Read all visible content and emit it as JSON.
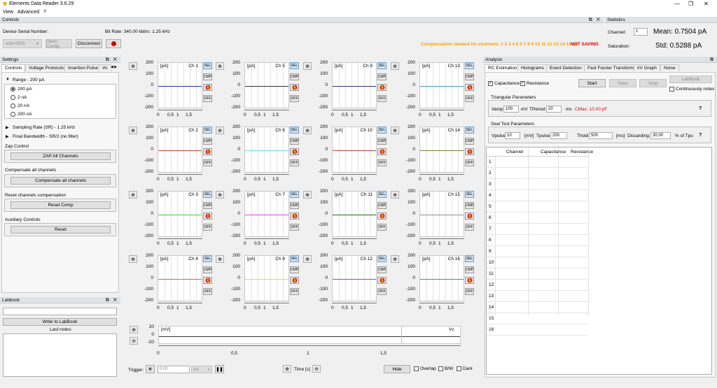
{
  "window": {
    "title": "Elements Data Reader 3.6.29",
    "controls": [
      "—",
      "❐",
      "✕"
    ]
  },
  "menu": [
    "View",
    "Advanced",
    "?"
  ],
  "controls_panel": {
    "header": "Controls",
    "serial_label": "Device Serial Number:",
    "serial_value": "e16-0003",
    "open_config": "Open Config",
    "disconnect": "Disconnect",
    "bitrate": "Bit Rate: 340.00 kbit/s: 1.25 kHz",
    "compensation_text": "Compensation needed for channels: 1 2 3 4 5 6 7 8 9 10 11 12 13 14 15 16",
    "not_saving": "NOT SAVING"
  },
  "statistics": {
    "header": "Statistics",
    "channel_label": "Channel:",
    "channel_value": "1",
    "mean": "Mean: 0.7504 pA",
    "saturation_label": "Saturation:",
    "std": "Std: 0.5288 pA"
  },
  "settings": {
    "header": "Settings",
    "tabs": [
      "Controls",
      "Voltage Protocols",
      "Insertion Pulse",
      "Vo"
    ],
    "range_label": "Range - 200 pA",
    "range_options": [
      "200 pA",
      "2 nA",
      "20 nA",
      "200 nA"
    ],
    "sampling_rate": "Sampling Rate (SR) - 1.25 kHz",
    "final_bandwidth": "Final Bandwidth - SR/2 (no filter)",
    "zap_section": "Zap Control",
    "zap_button": "ZAP All Channels",
    "comp_section": "Compensate all channels",
    "comp_button": "Compensate all channels",
    "reset_section": "Reset channels compensation",
    "reset_button": "Reset Comp",
    "aux_section": "Auxiliary Controls",
    "aux_button": "Reset"
  },
  "labbook": {
    "header": "Labbook",
    "write_button": "Write to LabBook",
    "last_notes": "Last notes:"
  },
  "plots": {
    "unit": "[pA]",
    "y_ticks": [
      "200",
      "100",
      "0",
      "-100",
      "-200"
    ],
    "x_ticks": [
      "0",
      "0,5",
      "1",
      "1,5"
    ],
    "channels": [
      {
        "label": "Ch 1",
        "color": "#2233cc"
      },
      {
        "label": "Ch 2",
        "color": "#e04040"
      },
      {
        "label": "Ch 3",
        "color": "#40d040"
      },
      {
        "label": "Ch 4",
        "color": "#d07020"
      },
      {
        "label": "Ch 5",
        "color": "#303030"
      },
      {
        "label": "Ch 6",
        "color": "#60e0e0"
      },
      {
        "label": "Ch 7",
        "color": "#e040e0"
      },
      {
        "label": "Ch 8",
        "color": "#e8e020"
      },
      {
        "label": "Ch 9",
        "color": "#303090"
      },
      {
        "label": "Ch 10",
        "color": "#d04040"
      },
      {
        "label": "Ch 11",
        "color": "#207020"
      },
      {
        "label": "Ch 12",
        "color": "#a040c0"
      },
      {
        "label": "Ch 13",
        "color": "#40a0c0"
      },
      {
        "label": "Ch 14",
        "color": "#808020"
      },
      {
        "label": "Ch 15",
        "color": "#909090"
      },
      {
        "label": "Ch 16",
        "color": "#20a080"
      }
    ],
    "side_buttons": [
      "SEL",
      "CMP",
      "OFF"
    ],
    "vc": {
      "unit": "[mV]",
      "label": "Vc",
      "y_ticks": [
        "20",
        "0",
        "-20"
      ],
      "x_ticks": [
        "0",
        "0,5",
        "1",
        "1,5"
      ]
    }
  },
  "bottom_bar": {
    "trigger_label": "Trigger:",
    "trigger_value": "0,00",
    "trigger_unit": "Vc",
    "time_label": "Time [s]",
    "hide_button": "Hide",
    "overlap": "Overlap",
    "bw": "B/W",
    "dark": "Dark"
  },
  "analysis": {
    "header": "Analysis",
    "tabs": [
      "RC Estimation",
      "Histograms",
      "Event Detection",
      "Fast Fourier Transform",
      "I/V Graph",
      "Noise"
    ],
    "capacitance_chk": "Capacitance",
    "resistance_chk": "Resistance",
    "labbook_button": "LabBook",
    "start_button": "Start",
    "save_button": "Save",
    "stop_button": "Stop",
    "continuously_notes": "Continuously notes",
    "triangular_header": "Triangular Parameters",
    "vamp_label": "Vamp",
    "vamp_value": "100",
    "mv_unit": "mV",
    "tperiod_label": "TPeriod",
    "tperiod_value": "20",
    "ms_unit": "ms",
    "cmax": "CMax: 10.00 pF",
    "seal_header": "Seal Test Parameters",
    "vpulse_label": "Vpulse",
    "vpulse_value": "10",
    "vpulse_unit": "[mV]",
    "tpulse_label": "Tpulse",
    "tpulse_value": "200",
    "thold_label": "Thold",
    "thold_value": "500",
    "thold_unit": "[ms]",
    "discarding_label": "Discarding:",
    "discarding_value": "30,00",
    "discarding_unit": "% of Tpu",
    "help": "?",
    "table_headers": [
      "Channel",
      "Capacitance",
      "Resistance"
    ],
    "rows": [
      "1",
      "2",
      "3",
      "4",
      "5",
      "6",
      "7",
      "8",
      "9",
      "10",
      "11",
      "12",
      "13",
      "14",
      "15",
      "16"
    ]
  },
  "accent": "#f2a400",
  "warning": "#e00000"
}
